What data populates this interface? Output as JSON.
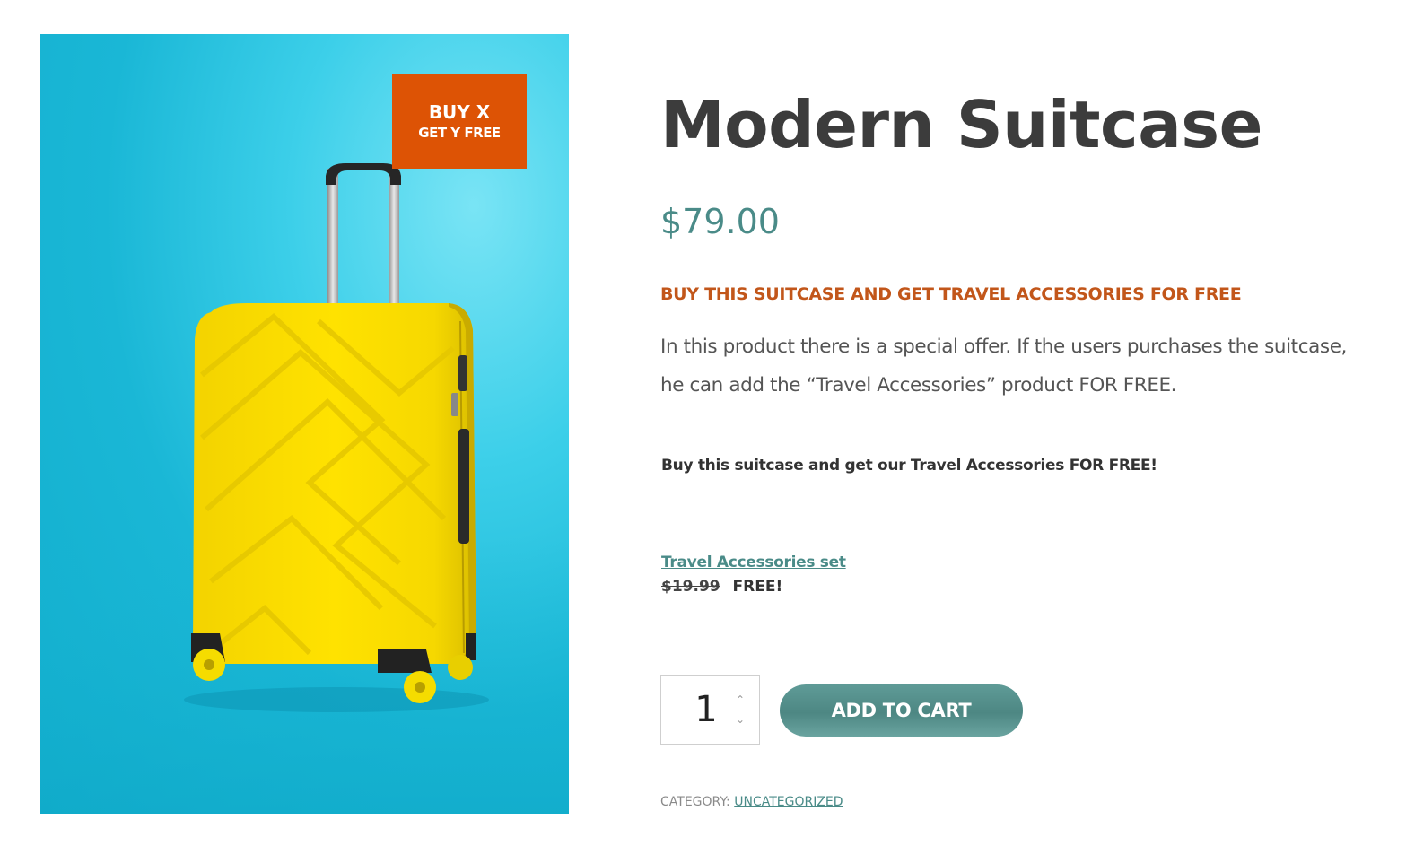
{
  "image": {
    "badge_line1": "BUY X",
    "badge_line2": "GET Y FREE",
    "badge_color": "#dd5305",
    "background_color": "#1ab7d6",
    "suitcase_color": "#ffe000"
  },
  "product": {
    "title": "Modern Suitcase",
    "price": "$79.00",
    "offer_heading": "BUY THIS SUITCASE AND GET TRAVEL ACCESSORIES FOR FREE",
    "description": "In this product there is a special offer. If the users purchases the suitcase, he can add the “Travel Accessories” product FOR FREE.",
    "offer_note": "Buy this suitcase and get our Travel Accessories FOR FREE!"
  },
  "free_product": {
    "name": "Travel Accessories set",
    "old_price": "$19.99",
    "new_price": "FREE!"
  },
  "cart": {
    "quantity": "1",
    "add_to_cart_label": "ADD TO CART"
  },
  "meta": {
    "category_label": "CATEGORY:",
    "category_value": "UNCATEGORIZED"
  },
  "colors": {
    "accent": "#4a8b88",
    "offer_heading": "#c2561a",
    "title": "#3c3c3c"
  }
}
